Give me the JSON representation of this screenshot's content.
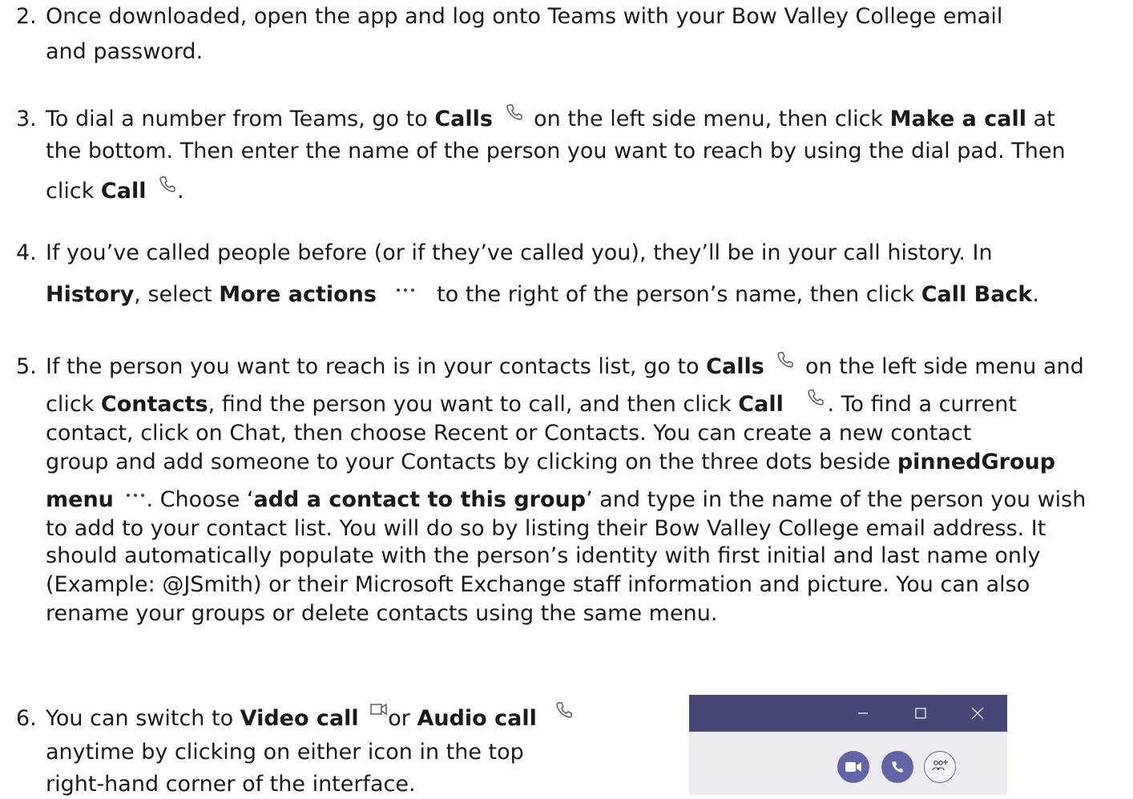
{
  "items": [
    {
      "number": "2.",
      "lines": [
        "Once downloaded, open the app and log onto Teams with your Bow Valley College email",
        "and password."
      ]
    },
    {
      "number": "3.",
      "l1a": "To dial a number from Teams, go to ",
      "l1b": "Calls",
      "l1c": " on the left side menu, then click ",
      "l1d": "Make a call",
      "l1e": " at",
      "l2": "the bottom. Then enter the name of the person you want to reach by using the dial pad. Then",
      "l3a": "click ",
      "l3b": "Call",
      "l3c": "."
    },
    {
      "number": "4.",
      "l1": "If you’ve called people before (or if they’ve called you), they’ll be in your call history. In",
      "l2a": "History",
      "l2b": ", select ",
      "l2c": "More actions",
      "l2d": " to the right of the person’s name, then click ",
      "l2e": "Call Back",
      "l2f": "."
    },
    {
      "number": "5.",
      "l1a": "If the person you want to reach is in your contacts list, go to ",
      "l1b": "Calls",
      "l1c": " on the left side menu and",
      "l2a": "click ",
      "l2b": "Contacts",
      "l2c": ", find the person you want to call, and then click ",
      "l2d": "Call",
      "l2e": ". To find a current",
      "l3": "contact, click on Chat, then choose Recent or Contacts. You can create a new contact",
      "l4a": "group and add someone to your Contacts by clicking on the three dots beside ",
      "l4b": "pinnedGroup",
      "l5a": "menu",
      "l5b": ".  Choose ‘",
      "l5c": "add a contact to this group",
      "l5d": "’ and type in the name of the person you wish",
      "l6": "to add to your contact list. You will do so by listing their Bow Valley College email address. It",
      "l7": "should automatically populate with the person’s identity with first initial and last name only",
      "l8": "(Example: @JSmith) or their Microsoft Exchange staff information and picture. You can also",
      "l9": "rename your groups or delete contacts using the same menu."
    },
    {
      "number": "6.",
      "l1a": "You can switch to ",
      "l1b": "Video call",
      "l1c": "or ",
      "l1d": "Audio call",
      "l2": "anytime by clicking on either icon in the top",
      "l3": "right-hand corner of the interface."
    }
  ],
  "window": {
    "title_bar_color": "#464775",
    "accent_color": "#6264a7",
    "controls": [
      "minimize-icon",
      "maximize-icon",
      "close-icon"
    ],
    "buttons": [
      "video-call-icon",
      "audio-call-icon",
      "add-people-icon"
    ]
  }
}
